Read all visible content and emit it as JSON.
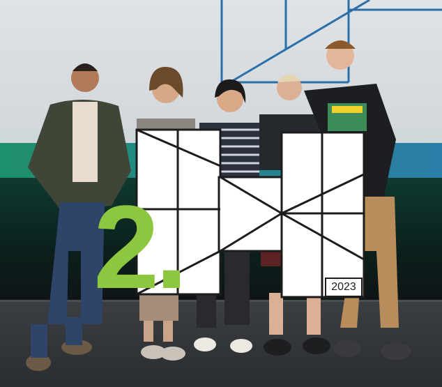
{
  "photo": {
    "board_year": "2023",
    "place_label": "2."
  },
  "colors": {
    "accent_green": "#8dc63f",
    "screen_line_blue": "#2b6ea8",
    "board_white": "#ffffff"
  }
}
